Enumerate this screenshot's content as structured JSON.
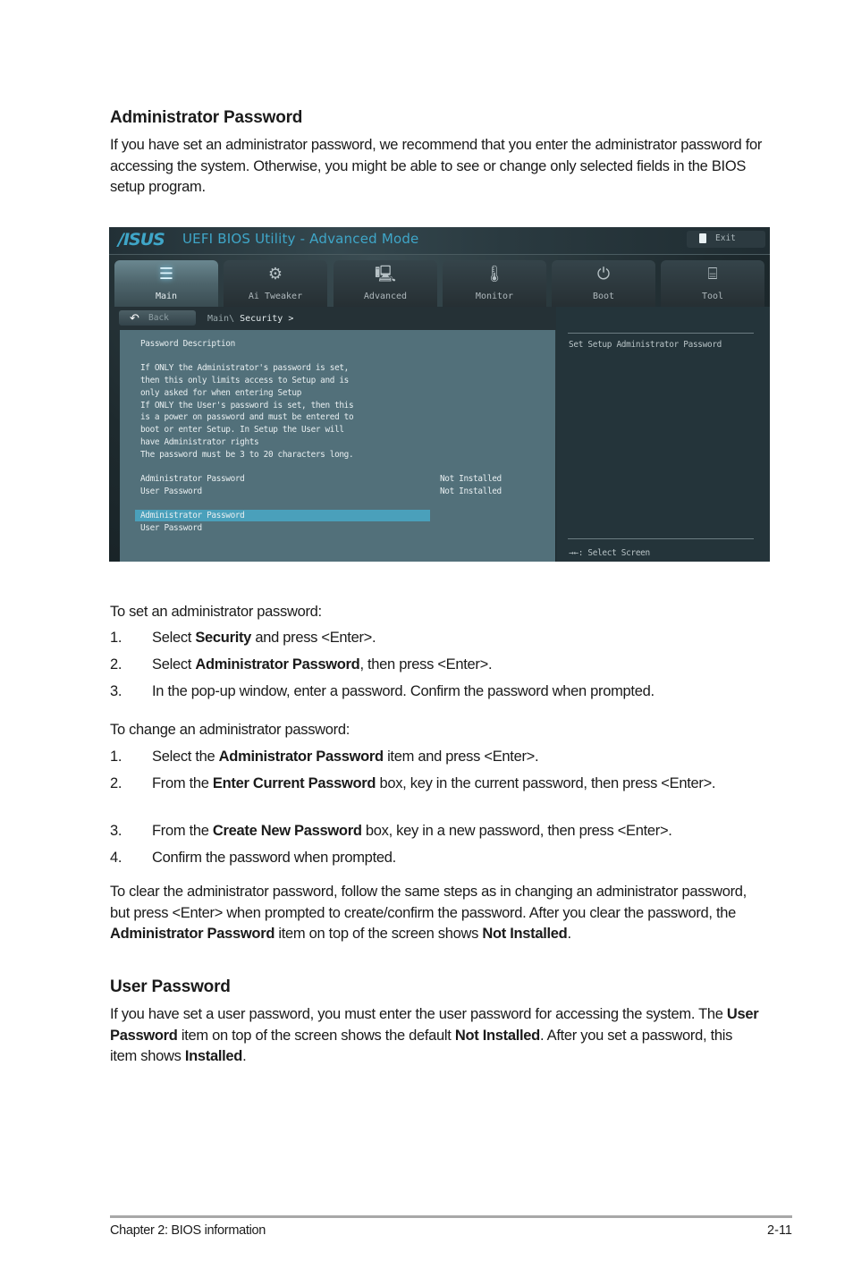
{
  "section1": {
    "heading": "Administrator Password",
    "intro": "If you have set an administrator password, we recommend that you enter the administrator password for accessing the system. Otherwise, you might be able to see or change only selected fields in the BIOS setup program."
  },
  "bios": {
    "logo": "/ISUS",
    "title": "UEFI BIOS Utility - Advanced Mode",
    "exit_label": "Exit",
    "tabs": [
      {
        "label": "Main",
        "icon": "list-icon",
        "glyph": "☰",
        "active": true
      },
      {
        "label": "Ai Tweaker",
        "icon": "tweaker-icon",
        "glyph": "⚙",
        "active": false
      },
      {
        "label": "Advanced",
        "icon": "advanced-info-icon",
        "glyph": "🖳",
        "active": false
      },
      {
        "label": "Monitor",
        "icon": "thermometer-icon",
        "glyph": "🌡",
        "active": false
      },
      {
        "label": "Boot",
        "icon": "power-icon",
        "glyph": "⏻",
        "active": false
      },
      {
        "label": "Tool",
        "icon": "toolbox-icon",
        "glyph": "⌸",
        "active": false
      }
    ],
    "back_label": "Back",
    "breadcrumb": {
      "parent": "Main\\",
      "current": "Security >"
    },
    "description_lines": [
      "Password Description",
      "",
      "If ONLY the Administrator's password is set,",
      "then this only limits access to Setup and is",
      "only asked for when entering Setup",
      "If ONLY the User's password is set, then this",
      "is a power on password and must be entered to",
      "boot or enter Setup. In Setup the User will",
      "have Administrator rights",
      "The password must be 3 to 20 characters long."
    ],
    "status_rows": [
      {
        "label": "Administrator Password",
        "value": "Not Installed"
      },
      {
        "label": "User Password",
        "value": "Not Installed"
      }
    ],
    "menu_items": [
      {
        "label": "Administrator Password",
        "selected": true
      },
      {
        "label": "User Password",
        "selected": false
      }
    ],
    "help_text": "Set Setup Administrator Password",
    "key_hint": "→←: Select Screen",
    "colors": {
      "accent": "#3fa6c8",
      "selection": "#4aa0bb",
      "panel": "#52707a"
    }
  },
  "set_steps": {
    "intro": "To set an administrator password:",
    "items": [
      {
        "num": "1.",
        "pre": "Select ",
        "bold": "Security",
        "post": " and press <Enter>."
      },
      {
        "num": "2.",
        "pre": "Select ",
        "bold": "Administrator Password",
        "post": ", then press <Enter>."
      },
      {
        "num": "3.",
        "pre": "In the pop-up window, enter a password.  Confirm the password when prompted.",
        "bold": "",
        "post": ""
      }
    ]
  },
  "change_steps": {
    "intro": "To change an administrator password:",
    "items": [
      {
        "num": "1.",
        "pre": "Select the ",
        "bold": "Administrator Password",
        "post": " item and press <Enter>."
      },
      {
        "num": "2.",
        "pre": "From the ",
        "bold": "Enter Current Password",
        "post": " box, key in the current password, then press <Enter>."
      },
      {
        "num": "3.",
        "pre": "From the ",
        "bold": "Create New Password",
        "post": " box, key in a new password, then press <Enter>."
      },
      {
        "num": "4.",
        "pre": "Confirm the password when prompted.",
        "bold": "",
        "post": ""
      }
    ]
  },
  "clear_para": {
    "t1": "To clear the administrator password, follow the same steps as in changing an administrator password, but press <Enter> when prompted to create/confirm the password. After you clear the password, the ",
    "b1": "Administrator Password",
    "t2": " item on top of the screen shows ",
    "b2": "Not Installed",
    "t3": "."
  },
  "section2": {
    "heading": "User Password",
    "t1": "If you have set a user password, you must enter the user password for accessing the system. The ",
    "b1": "User Password",
    "t2": " item on top of the screen shows the default ",
    "b2": "Not Installed",
    "t3": ". After you set a password, this item shows ",
    "b3": "Installed",
    "t4": "."
  },
  "footer": {
    "chapter": "Chapter 2: BIOS information",
    "page": "2-11"
  }
}
